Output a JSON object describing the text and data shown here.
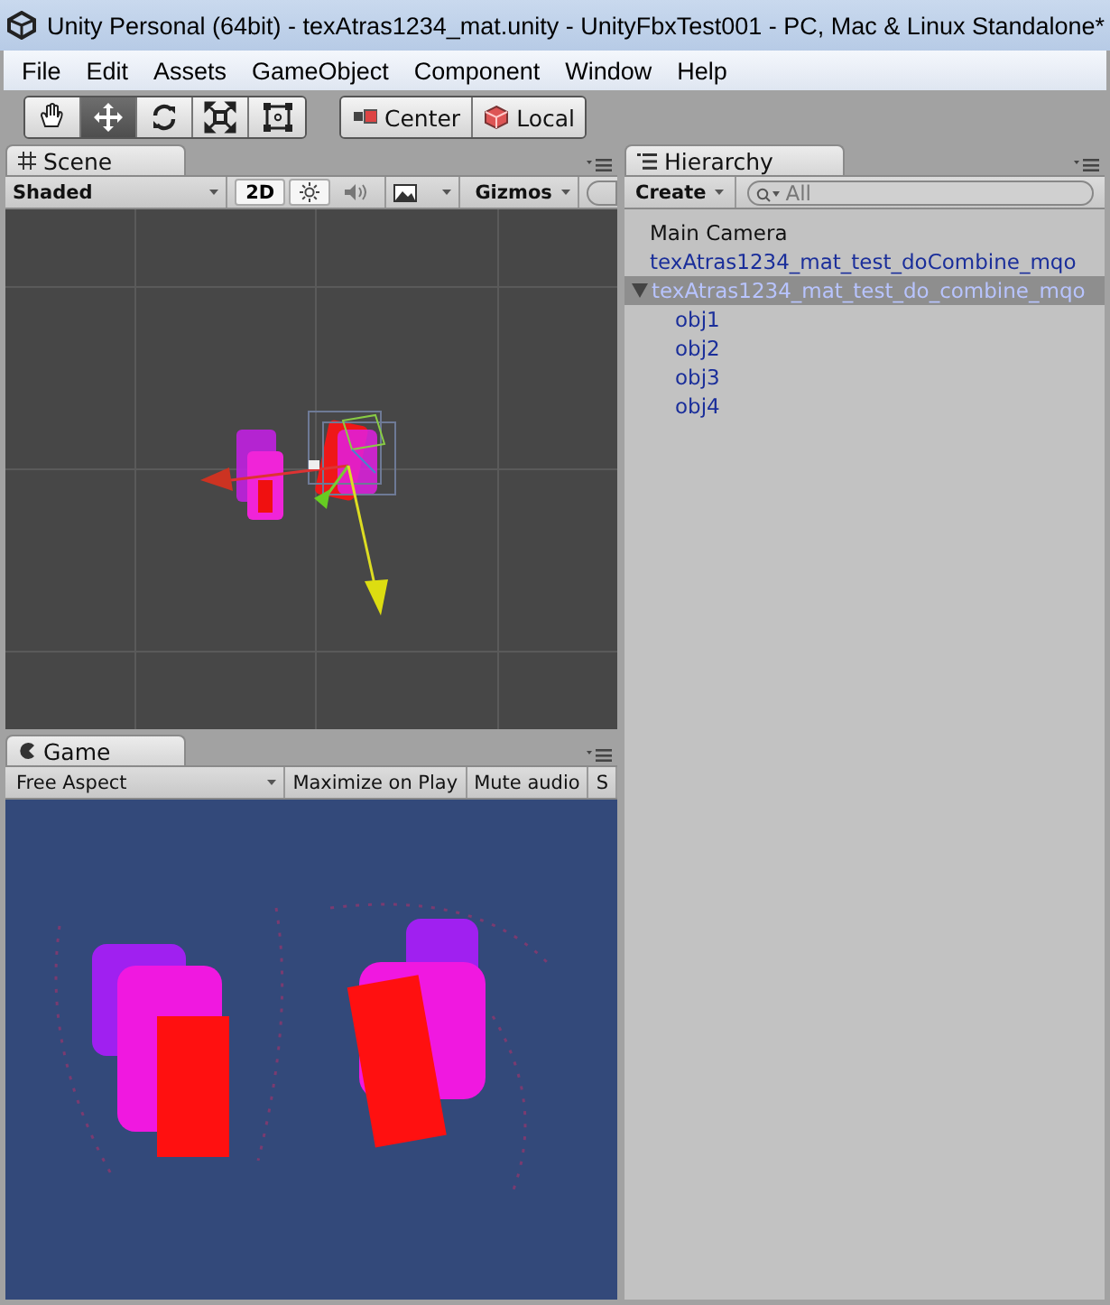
{
  "window": {
    "title": "Unity Personal (64bit) - texAtras1234_mat.unity - UnityFbxTest001 - PC, Mac & Linux Standalone*"
  },
  "menu": [
    "File",
    "Edit",
    "Assets",
    "GameObject",
    "Component",
    "Window",
    "Help"
  ],
  "toolbar": {
    "tools": [
      {
        "kind": "hand",
        "selected": false
      },
      {
        "kind": "move",
        "selected": true
      },
      {
        "kind": "rotate",
        "selected": false
      },
      {
        "kind": "scale",
        "selected": false
      },
      {
        "kind": "rect",
        "selected": false
      }
    ],
    "pivot": [
      {
        "kind": "center",
        "label": "Center"
      },
      {
        "kind": "local",
        "label": "Local"
      }
    ]
  },
  "scene": {
    "tab": "Scene",
    "shading": "Shaded",
    "mode_2d": "2D",
    "lighting_on": true,
    "audio_on": false,
    "gizmos": "Gizmos"
  },
  "game": {
    "tab": "Game",
    "aspect": "Free Aspect",
    "buttons": [
      "Maximize on Play",
      "Mute audio",
      "S"
    ]
  },
  "hierarchy": {
    "tab": "Hierarchy",
    "create": "Create",
    "search": {
      "placeholder": "All"
    },
    "items": [
      {
        "label": "Main Camera",
        "prefab": false,
        "selected": false
      },
      {
        "label": "texAtras1234_mat_test_doCombine_mqo",
        "prefab": true,
        "selected": false
      },
      {
        "label": "texAtras1234_mat_test_do_combine_mqo",
        "prefab": true,
        "selected": true,
        "expanded": true,
        "children": [
          {
            "label": "obj1",
            "prefab": true,
            "selected": false
          },
          {
            "label": "obj2",
            "prefab": true,
            "selected": false
          },
          {
            "label": "obj3",
            "prefab": true,
            "selected": false
          },
          {
            "label": "obj4",
            "prefab": true,
            "selected": false
          }
        ]
      }
    ]
  }
}
